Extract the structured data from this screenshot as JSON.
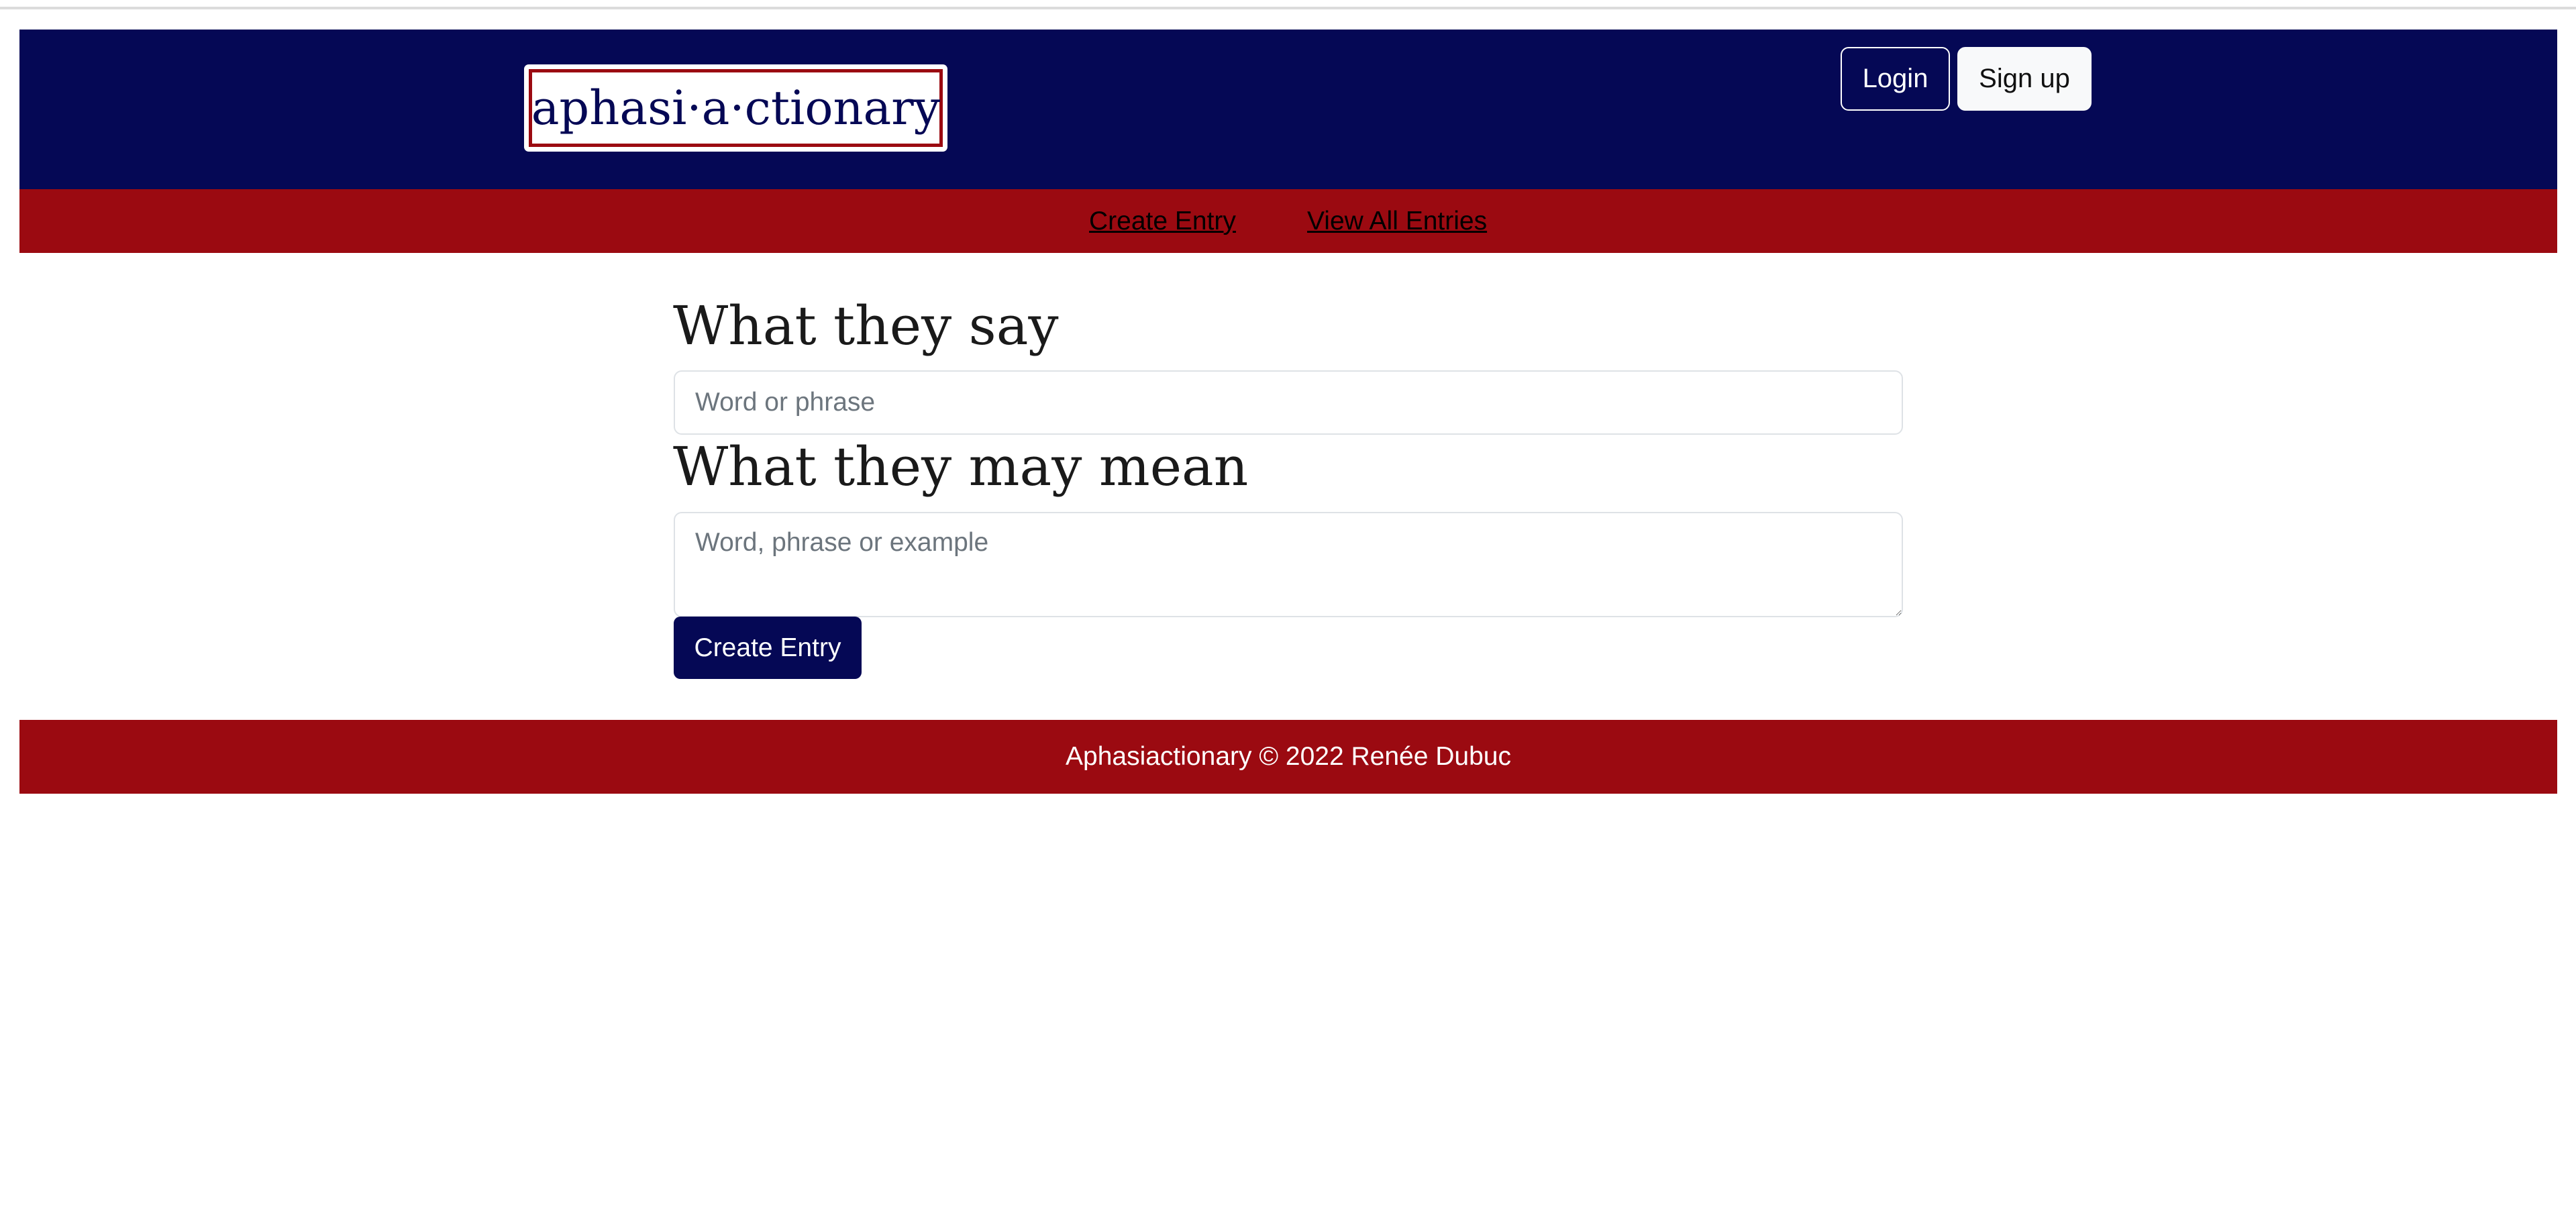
{
  "header": {
    "logo_text": "aphasi·a·ctionary",
    "login_label": "Login",
    "signup_label": "Sign up"
  },
  "nav": {
    "items": [
      {
        "label": "Create Entry"
      },
      {
        "label": "View All Entries"
      }
    ]
  },
  "form": {
    "say_heading": "What they say",
    "say_placeholder": "Word or phrase",
    "say_value": "",
    "mean_heading": "What they may mean",
    "mean_placeholder": "Word, phrase or example",
    "mean_value": "",
    "submit_label": "Create Entry"
  },
  "footer": {
    "text": "Aphasiactionary © 2022 Renée Dubuc"
  },
  "colors": {
    "primary_navy": "#050855",
    "accent_red": "#9b0a11",
    "background": "#ffffff"
  }
}
